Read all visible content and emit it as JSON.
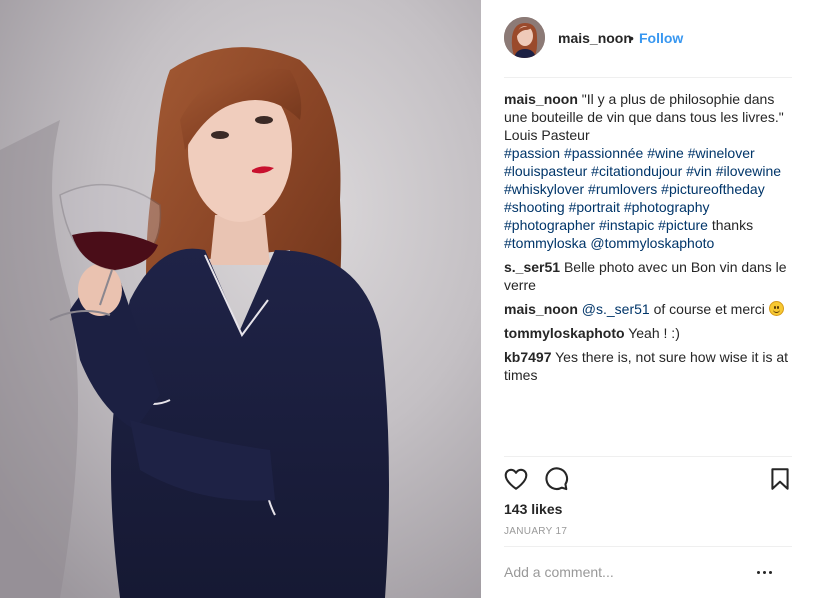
{
  "post": {
    "username": "mais_noon",
    "separator": "•",
    "follow_label": "Follow"
  },
  "caption": {
    "username": "mais_noon",
    "text": "\"Il y a plus de philosophie dans une bouteille de vin que dans tous les livres.\" Louis Pasteur",
    "hashtags_part1": [
      "#passion",
      "#passionnée",
      "#wine",
      "#winelover",
      "#louispasteur",
      "#citationdujour",
      "#vin",
      "#ilovewine",
      "#whiskylover",
      "#rumlovers",
      "#pictureoftheday",
      "#shooting",
      "#portrait",
      "#photography",
      "#photographer",
      "#instapic",
      "#picture"
    ],
    "middle_text": "thanks",
    "hashtags_part2": [
      "#tommyloska"
    ],
    "trailing_mention": "@tommyloskaphoto"
  },
  "comments": [
    {
      "user": "s._ser51",
      "text": "Belle photo avec un Bon vin dans le verre"
    },
    {
      "user": "mais_noon",
      "mention": "@s._ser51",
      "text": "of course et merci",
      "emoji": "smiling-face-emoji"
    },
    {
      "user": "tommyloskaphoto",
      "text": "Yeah ! :)"
    },
    {
      "user": "kb7497",
      "text": "Yes there is, not sure how wise it is at times"
    }
  ],
  "actions": {
    "like_icon": "heart-icon",
    "comment_icon": "speech-bubble-icon",
    "save_icon": "bookmark-icon"
  },
  "likes_text": "143 likes",
  "date_text": "JANUARY 17",
  "add_comment": {
    "placeholder": "Add a comment...",
    "value": ""
  },
  "more_icon": "ellipsis-icon",
  "colors": {
    "link_blue": "#3897f0",
    "hashtag": "#003569",
    "text": "#262626",
    "muted": "#999999",
    "divider": "#efefef"
  }
}
